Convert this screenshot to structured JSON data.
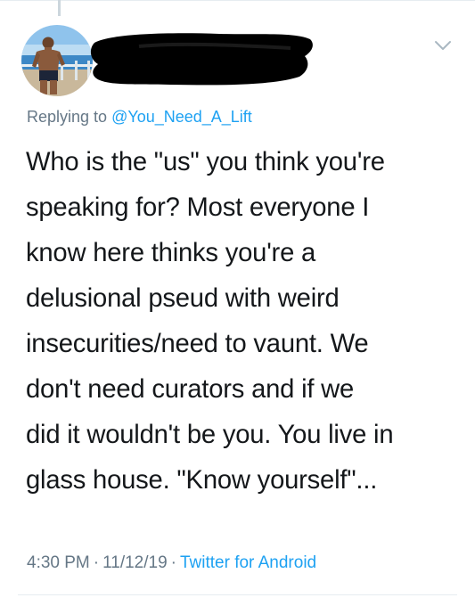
{
  "reply": {
    "prefix": "Replying to",
    "handle": "@You_Need_A_Lift"
  },
  "tweet": {
    "lines": [
      "Who is the \"us\" you think you're",
      "speaking for? Most everyone I",
      "know here thinks you're a",
      "delusional pseud with weird",
      "insecurities/need to vaunt. We",
      "don't need curators and if we",
      "did it wouldn't be you. You live in",
      "glass house. \"Know yourself\"..."
    ]
  },
  "meta": {
    "time": "4:30 PM",
    "date": "11/12/19",
    "separator": "·",
    "source": "Twitter for Android"
  },
  "icons": {
    "menu": "chevron-down-icon"
  },
  "colors": {
    "link": "#1da1f2",
    "secondary_text": "#657786",
    "primary_text": "#14171a",
    "divider": "#e6ecf0",
    "redaction": "#000000"
  }
}
